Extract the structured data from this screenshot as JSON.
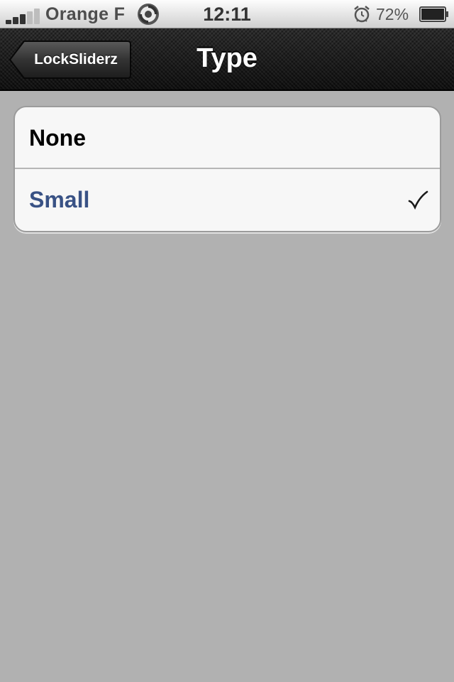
{
  "status_bar": {
    "carrier": "Orange F",
    "time": "12:11",
    "battery_percent": "72%",
    "signal_bars_filled": 3,
    "signal_bars_total": 5,
    "battery_level": 0.72,
    "icons": [
      "signal-icon",
      "sync-icon",
      "alarm-icon",
      "battery-icon"
    ]
  },
  "nav_bar": {
    "back_label": "LockSliderz",
    "title": "Type"
  },
  "options": [
    {
      "label": "None",
      "selected": false
    },
    {
      "label": "Small",
      "selected": true
    }
  ],
  "colors": {
    "background": "#b1b1b1",
    "selected_text": "#395285",
    "cell_background": "#f7f7f7"
  }
}
